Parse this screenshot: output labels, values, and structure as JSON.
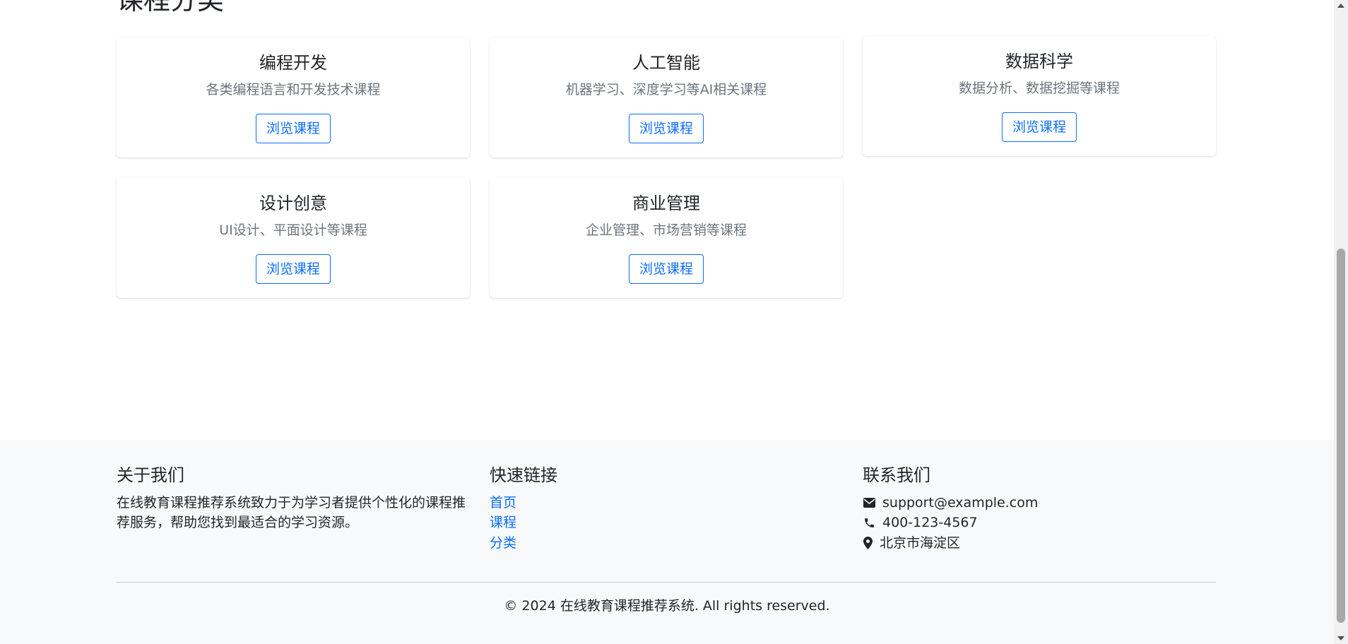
{
  "section": {
    "title": "课程分类"
  },
  "categories": [
    {
      "title": "编程开发",
      "desc": "各类编程语言和开发技术课程",
      "button": "浏览课程"
    },
    {
      "title": "人工智能",
      "desc": "机器学习、深度学习等AI相关课程",
      "button": "浏览课程"
    },
    {
      "title": "数据科学",
      "desc": "数据分析、数据挖掘等课程",
      "button": "浏览课程"
    },
    {
      "title": "设计创意",
      "desc": "UI设计、平面设计等课程",
      "button": "浏览课程"
    },
    {
      "title": "商业管理",
      "desc": "企业管理、市场营销等课程",
      "button": "浏览课程"
    }
  ],
  "footer": {
    "about": {
      "title": "关于我们",
      "text": "在线教育课程推荐系统致力于为学习者提供个性化的课程推荐服务，帮助您找到最适合的学习资源。"
    },
    "links": {
      "title": "快速链接",
      "items": [
        "首页",
        "课程",
        "分类"
      ]
    },
    "contact": {
      "title": "联系我们",
      "email": "support@example.com",
      "phone": "400-123-4567",
      "address": "北京市海淀区",
      "icons": [
        "envelope-icon",
        "phone-icon",
        "map-marker-icon"
      ]
    },
    "copyright": "© 2024 在线教育课程推荐系统. All rights reserved."
  },
  "colors": {
    "primary": "#0d6efd",
    "muted": "#6c757d",
    "footer_bg": "#f8f9fa"
  }
}
